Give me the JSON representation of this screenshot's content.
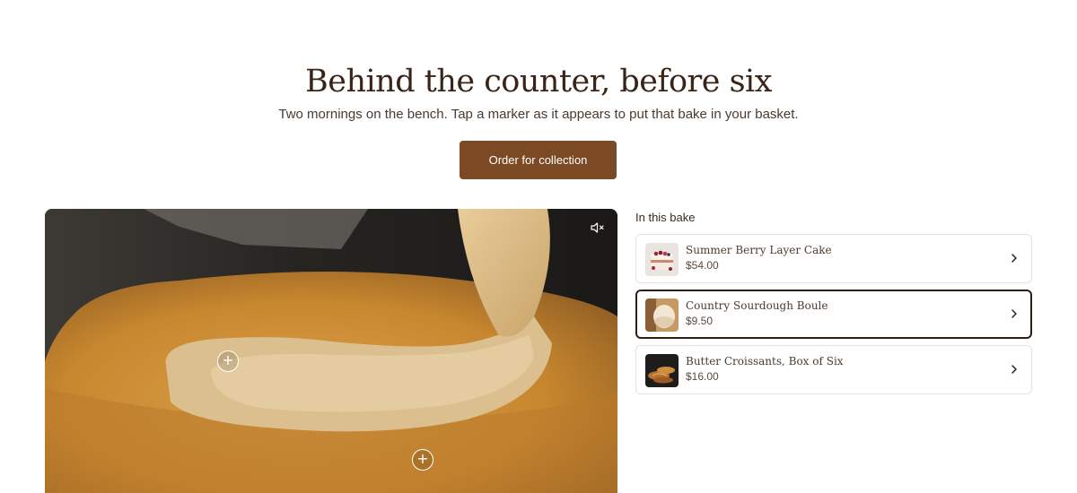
{
  "hero": {
    "title": "Behind the counter, before six",
    "subtitle": "Two mornings on the bench. Tap a marker as it appears to put that bake in your basket.",
    "cta_label": "Order for collection"
  },
  "video": {
    "mute_icon": "volume-muted-icon",
    "markers": [
      {
        "icon": "plus-icon",
        "label": "+"
      },
      {
        "icon": "plus-icon",
        "label": "+"
      }
    ]
  },
  "panel": {
    "heading": "In this bake",
    "products": [
      {
        "name": "Summer Berry Layer Cake",
        "price": "$54.00",
        "active": false,
        "icon": "chevron-right-icon"
      },
      {
        "name": "Country Sourdough Boule",
        "price": "$9.50",
        "active": true,
        "icon": "chevron-right-icon"
      },
      {
        "name": "Butter Croissants, Box of Six",
        "price": "$16.00",
        "active": false,
        "icon": "chevron-right-icon"
      }
    ]
  },
  "colors": {
    "accent": "#7b4a25",
    "title": "#3a2417",
    "active_border": "#2e1f16"
  }
}
